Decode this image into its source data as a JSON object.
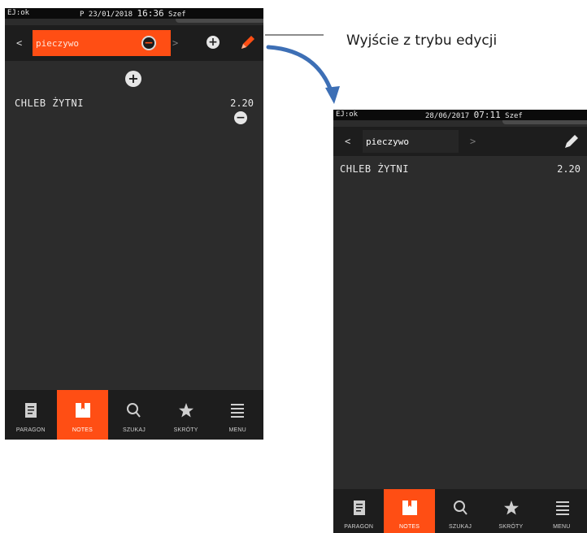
{
  "annotation": {
    "text": "Wyjście z trybu edycji"
  },
  "screen_edit": {
    "status": {
      "ej": "EJ:ok",
      "date": "P 23/01/2018",
      "time": "16:36",
      "user": "Szef"
    },
    "category": {
      "prev": "<",
      "name": "pieczywo",
      "next": ">"
    },
    "items": [
      {
        "name": "CHLEB ŻYTNI",
        "price": "2.20"
      }
    ]
  },
  "screen_normal": {
    "status": {
      "ej": "EJ:ok",
      "date": "28/06/2017",
      "time": "07:11",
      "user": "Szef"
    },
    "category": {
      "prev": "<",
      "name": "pieczywo",
      "next": ">"
    },
    "items": [
      {
        "name": "CHLEB ŻYTNI",
        "price": "2.20"
      }
    ]
  },
  "nav": {
    "items": [
      {
        "label": "PARAGON",
        "icon": "receipt-icon",
        "active": false
      },
      {
        "label": "NOTES",
        "icon": "notes-icon",
        "active": true
      },
      {
        "label": "SZUKAJ",
        "icon": "search-icon",
        "active": false
      },
      {
        "label": "SKRÓTY",
        "icon": "star-icon",
        "active": false
      },
      {
        "label": "MENU",
        "icon": "menu-icon",
        "active": false
      }
    ]
  },
  "colors": {
    "accent": "#ff4e14",
    "background": "#2c2c2c",
    "bar": "#1d1d1d",
    "text": "#e8e8e8"
  }
}
